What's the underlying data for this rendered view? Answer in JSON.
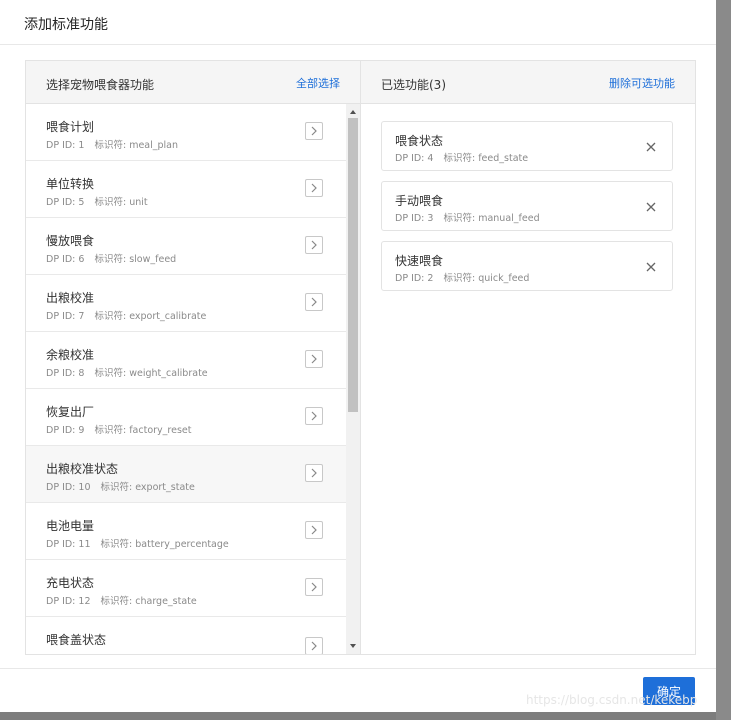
{
  "dialog": {
    "title": "添加标准功能"
  },
  "left_panel": {
    "title": "选择宠物喂食器功能",
    "action": "全部选择",
    "meta_id_prefix": "DP ID:",
    "meta_code_prefix": "标识符:",
    "items": [
      {
        "name": "喂食计划",
        "dp_id": "1",
        "code": "meal_plan"
      },
      {
        "name": "单位转换",
        "dp_id": "5",
        "code": "unit"
      },
      {
        "name": "慢放喂食",
        "dp_id": "6",
        "code": "slow_feed"
      },
      {
        "name": "出粮校准",
        "dp_id": "7",
        "code": "export_calibrate"
      },
      {
        "name": "余粮校准",
        "dp_id": "8",
        "code": "weight_calibrate"
      },
      {
        "name": "恢复出厂",
        "dp_id": "9",
        "code": "factory_reset"
      },
      {
        "name": "出粮校准状态",
        "dp_id": "10",
        "code": "export_state"
      },
      {
        "name": "电池电量",
        "dp_id": "11",
        "code": "battery_percentage"
      },
      {
        "name": "充电状态",
        "dp_id": "12",
        "code": "charge_state"
      },
      {
        "name": "喂食盖状态",
        "dp_id": "",
        "code": ""
      }
    ]
  },
  "right_panel": {
    "title": "已选功能(3)",
    "action": "删除可选功能",
    "items": [
      {
        "name": "喂食状态",
        "dp_id": "4",
        "code": "feed_state"
      },
      {
        "name": "手动喂食",
        "dp_id": "3",
        "code": "manual_feed"
      },
      {
        "name": "快速喂食",
        "dp_id": "2",
        "code": "quick_feed"
      }
    ]
  },
  "footer": {
    "ok_label": "确定"
  },
  "watermark": "https://blog.csdn.net/kekebp",
  "colors": {
    "accent": "#1e6fd9",
    "border": "#e3e3e3",
    "header_bg": "#f5f5f5"
  }
}
